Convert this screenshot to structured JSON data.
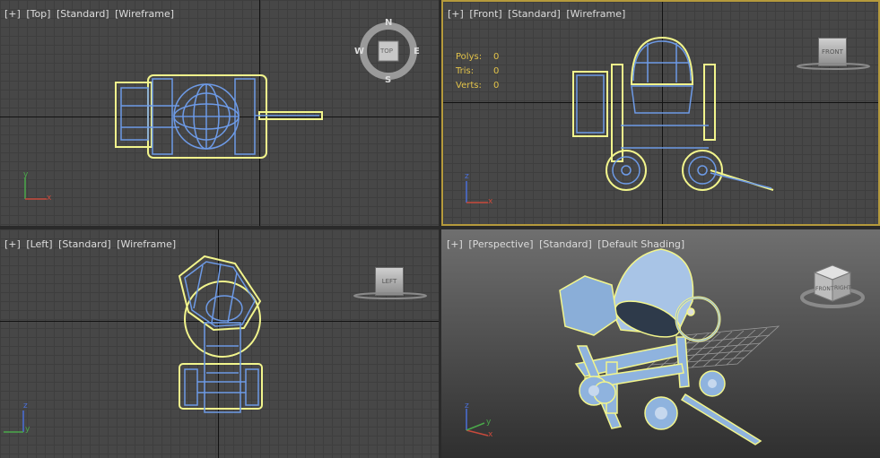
{
  "viewports": {
    "top": {
      "labels": [
        "[+]",
        "[Top]",
        "[Standard]",
        "[Wireframe]"
      ],
      "compass": {
        "n": "N",
        "s": "S",
        "e": "E",
        "w": "W",
        "cube": "TOP"
      }
    },
    "front": {
      "labels": [
        "[+]",
        "[Front]",
        "[Standard]",
        "[Wireframe]"
      ],
      "stats": [
        {
          "key": "Polys:",
          "value": "0"
        },
        {
          "key": "Tris:",
          "value": "0"
        },
        {
          "key": "Verts:",
          "value": "0"
        }
      ],
      "cube": "FRONT"
    },
    "left": {
      "labels": [
        "[+]",
        "[Left]",
        "[Standard]",
        "[Wireframe]"
      ],
      "cube": "LEFT"
    },
    "perspective": {
      "labels": [
        "[+]",
        "[Perspective]",
        "[Standard]",
        "[Default Shading]"
      ],
      "cube_front": "FRONT",
      "cube_right": "RIGHT"
    }
  },
  "axis_gizmo": {
    "x": "x",
    "y": "y",
    "z": "z"
  },
  "colors": {
    "selection": "#f2f58c",
    "wire": "#6d9ae6",
    "active_border": "#b59a3c",
    "stats_text": "#e3c44a",
    "model_fill": "#8fb3de"
  }
}
